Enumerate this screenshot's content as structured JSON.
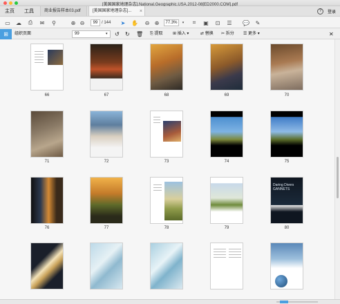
{
  "window": {
    "title": "[美国国家地理杂志].National.Geographic.USA.2012-08[ED2000.COM].pdf"
  },
  "menu": {
    "home": "主页",
    "tools": "工具"
  },
  "tabs": [
    {
      "label": "商业报告样本03.pdf"
    },
    {
      "label": "[美国国家地理杂志]..."
    }
  ],
  "account": {
    "login": "登录",
    "help": "?"
  },
  "toolbar": {
    "current_page": "99",
    "total_pages": "/ 144",
    "zoom": "77.3%"
  },
  "toolbar2": {
    "organize_label": "组织页面",
    "page_select": "99",
    "extract": "提取",
    "insert": "插入",
    "replace": "替换",
    "split": "拆分",
    "more": "更多"
  },
  "page_labels": [
    "66",
    "67",
    "68",
    "69",
    "70",
    "71",
    "72",
    "73",
    "74",
    "75",
    "76",
    "77",
    "78",
    "79",
    "80"
  ],
  "magazine_text": {
    "cover_headline": "Daring Divers GANNETS"
  },
  "colors": {
    "accent": "#4a9fe0"
  }
}
